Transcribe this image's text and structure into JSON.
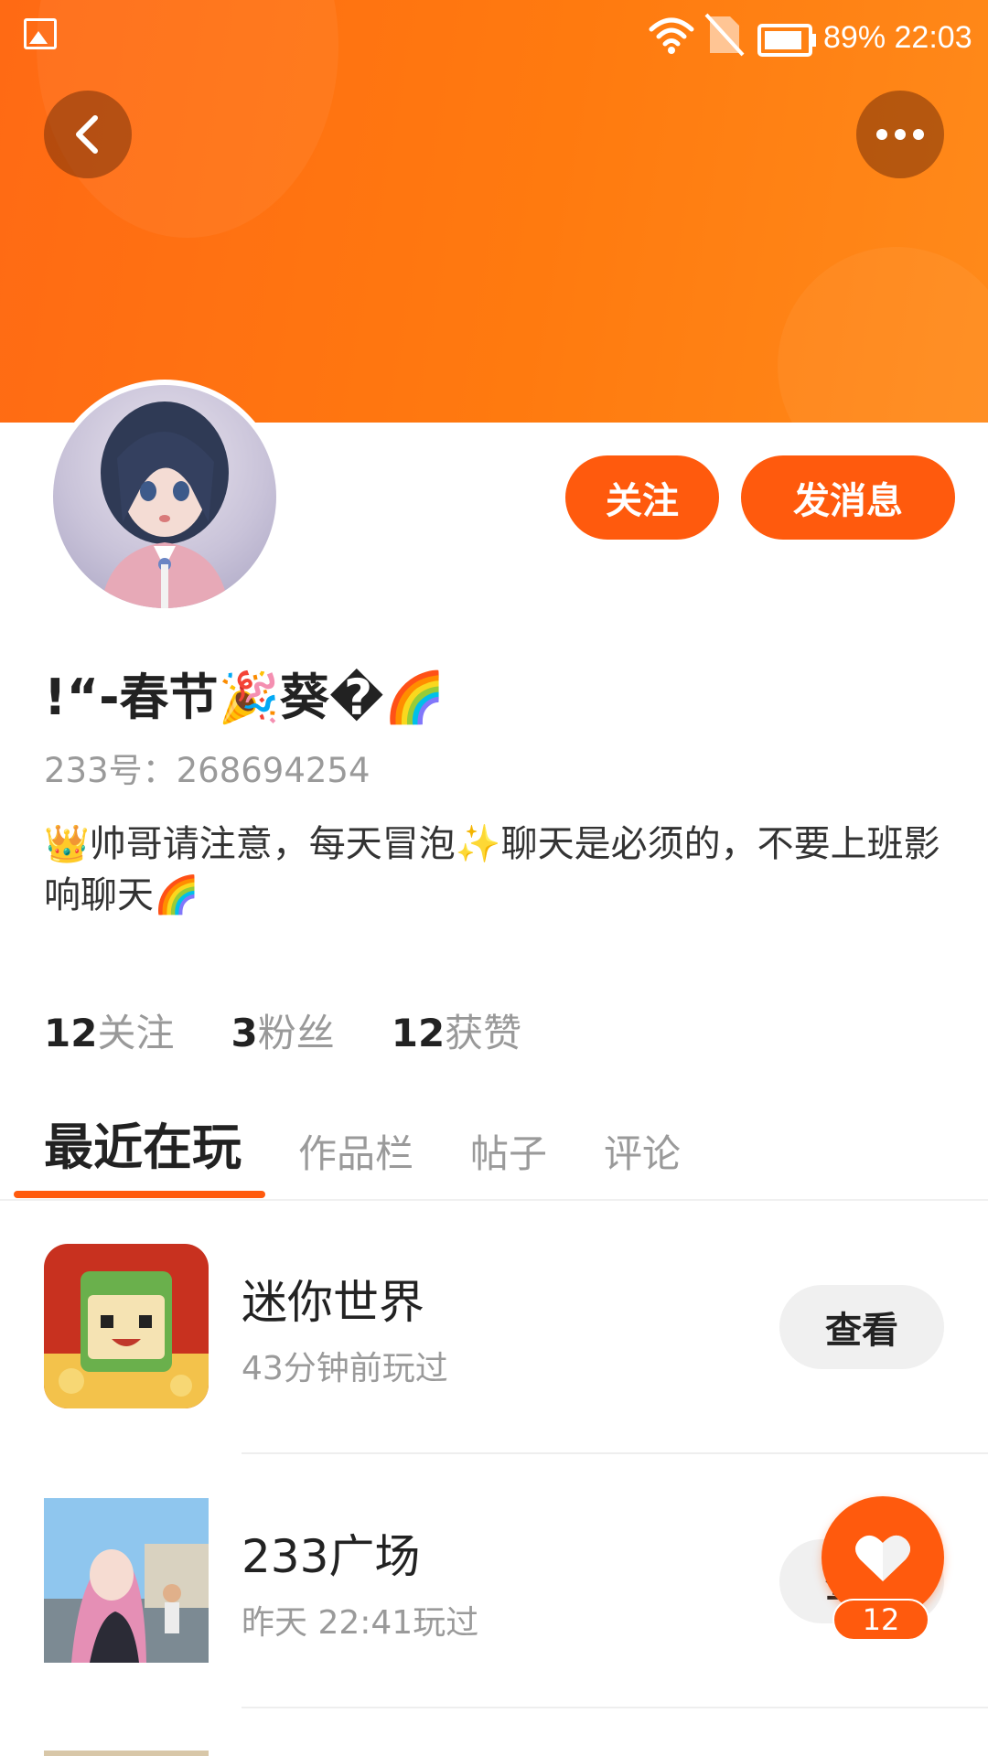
{
  "status_bar": {
    "battery": "89%",
    "time": "22:03",
    "icons": [
      "gallery-icon",
      "wifi-icon",
      "no-sim-icon",
      "battery-icon"
    ]
  },
  "header": {
    "back_icon": "chevron-left-icon",
    "more_icon": "more-dots-icon"
  },
  "profile": {
    "nickname": "!“-春节🎉葵�🌈",
    "uid": "233号：268694254",
    "bio": "👑帅哥请注意，每天冒泡✨聊天是必须的，不要上班影响聊天🌈",
    "follow_label": "关注",
    "message_label": "发消息"
  },
  "stats": [
    {
      "num": "12",
      "label": "关注"
    },
    {
      "num": "3",
      "label": "粉丝"
    },
    {
      "num": "12",
      "label": "获赞"
    }
  ],
  "tabs": [
    {
      "label": "最近在玩",
      "active": true
    },
    {
      "label": "作品栏"
    },
    {
      "label": "帖子"
    },
    {
      "label": "评论"
    }
  ],
  "games": [
    {
      "title": "迷你世界",
      "subtitle": "43分钟前玩过",
      "action": "查看"
    },
    {
      "title": "233广场",
      "subtitle": "昨天 22:41玩过",
      "action": "查看"
    }
  ],
  "like": {
    "count": "12",
    "icon": "heart-icon"
  },
  "colors": {
    "accent": "#ff5a0d",
    "banner": "#ff7a10"
  }
}
